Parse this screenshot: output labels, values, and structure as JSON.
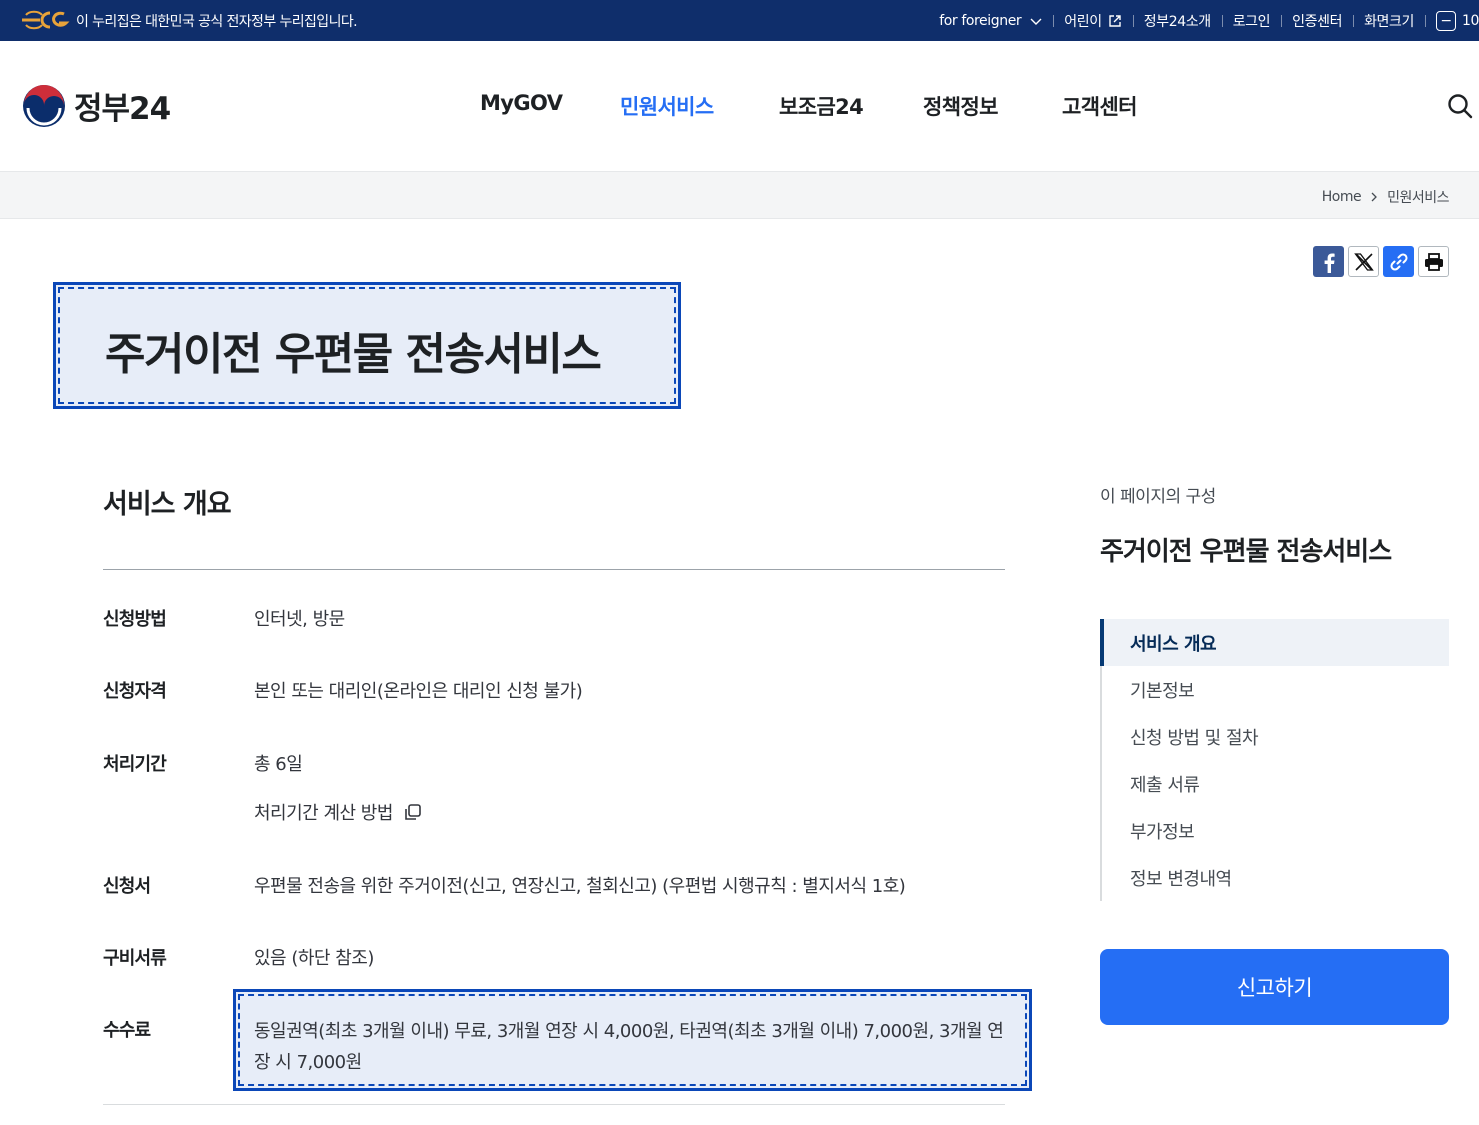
{
  "topbar": {
    "notice": "이 누리집은 대한민국 공식 전자정부 누리집입니다.",
    "links": [
      {
        "label": "for foreigner"
      },
      {
        "label": "어린이"
      },
      {
        "label": "정부24소개"
      },
      {
        "label": "로그인"
      },
      {
        "label": "인증센터"
      },
      {
        "label": "화면크기"
      }
    ],
    "zoom_minus": "−",
    "zoom_value": "10"
  },
  "header": {
    "brand": "정부24",
    "nav": [
      {
        "label": "MyGOV"
      },
      {
        "label": "민원서비스",
        "active": true
      },
      {
        "label": "보조금24"
      },
      {
        "label": "정책정보"
      },
      {
        "label": "고객센터"
      }
    ]
  },
  "breadcrumb": {
    "home": "Home",
    "current": "민원서비스"
  },
  "page": {
    "title": "주거이전 우편물 전송서비스"
  },
  "overview": {
    "heading": "서비스 개요",
    "rows": [
      {
        "label": "신청방법",
        "value": "인터넷, 방문"
      },
      {
        "label": "신청자격",
        "value": "본인 또는 대리인(온라인은 대리인 신청 불가)"
      },
      {
        "label": "처리기간",
        "value": "총 6일",
        "link": "처리기간 계산 방법"
      },
      {
        "label": "신청서",
        "value": "우편물 전송을 위한 주거이전(신고, 연장신고, 철회신고) (우편법 시행규칙 : 별지서식 1호)"
      },
      {
        "label": "구비서류",
        "value": "있음 (하단 참조)"
      },
      {
        "label": "수수료",
        "value": "동일권역(최초 3개월 이내) 무료, 3개월 연장 시 4,000원, 타권역(최초 3개월 이내) 7,000원, 3개월 연장 시 7,000원"
      }
    ]
  },
  "toc": {
    "caption": "이 페이지의 구성",
    "title": "주거이전 우편물 전송서비스",
    "items": [
      {
        "label": "서비스 개요",
        "active": true
      },
      {
        "label": "기본정보"
      },
      {
        "label": "신청 방법 및 절차"
      },
      {
        "label": "제출 서류"
      },
      {
        "label": "부가정보"
      },
      {
        "label": "정보 변경내역"
      }
    ],
    "cta": "신고하기"
  },
  "colors": {
    "topbar": "#0f2e6b",
    "accent": "#256ef4",
    "highlight_border": "#0b47b8",
    "highlight_fill": "#e7edf8"
  }
}
